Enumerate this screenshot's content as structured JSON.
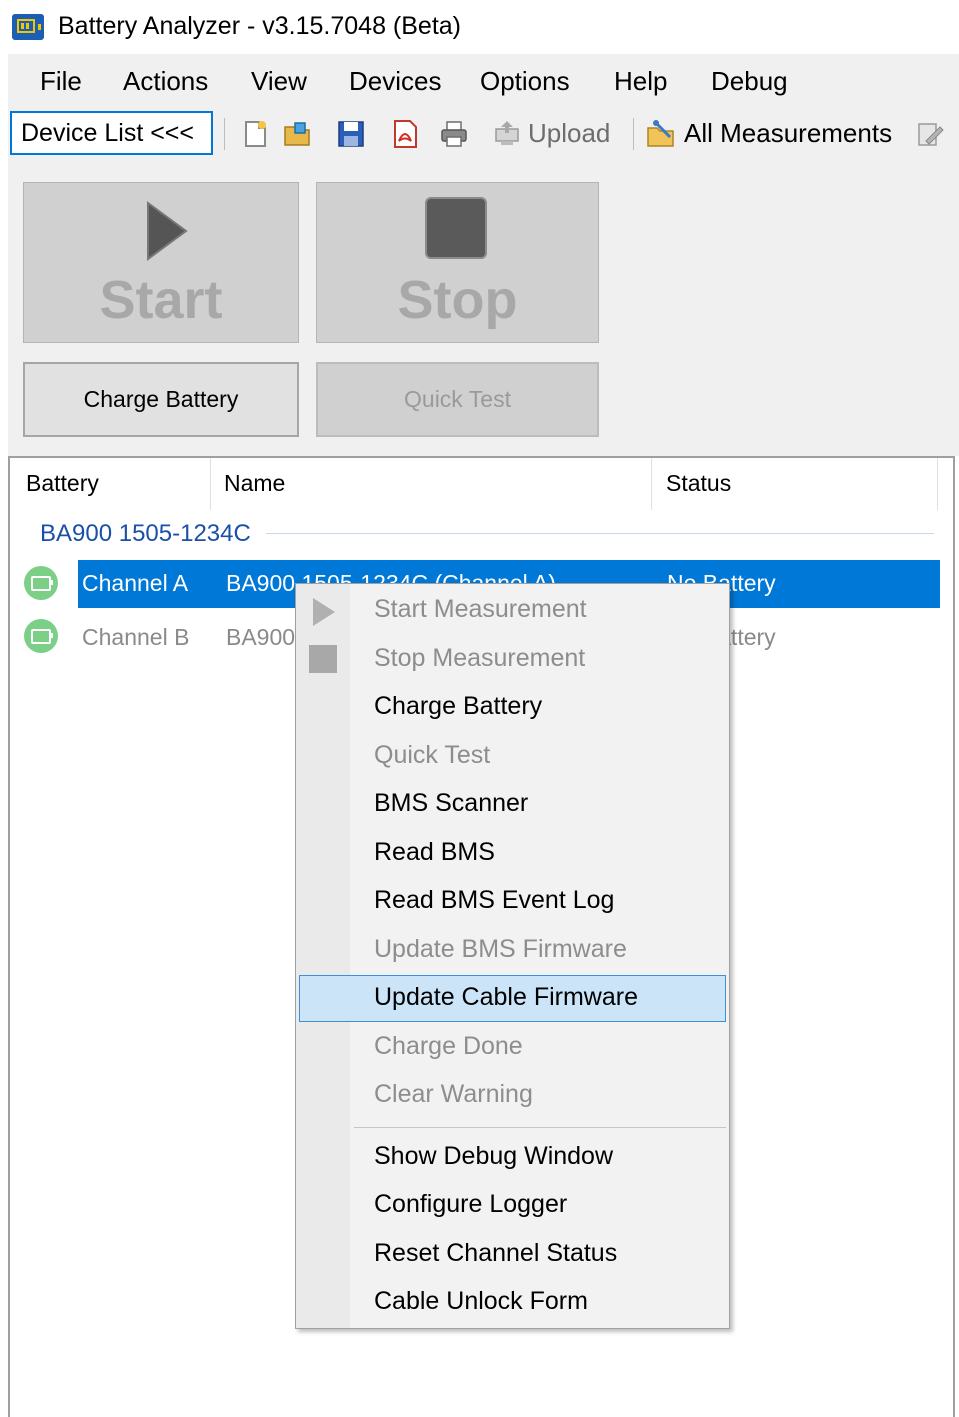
{
  "window": {
    "title": "Battery Analyzer - v3.15.7048 (Beta)"
  },
  "menubar": {
    "items": [
      "File",
      "Actions",
      "View",
      "Devices",
      "Options",
      "Help",
      "Debug"
    ]
  },
  "toolbar": {
    "device_list_label": "Device List <<<",
    "upload_label": "Upload",
    "all_measurements_label": "All Measurements"
  },
  "controls": {
    "start_label": "Start",
    "stop_label": "Stop",
    "charge_battery_label": "Charge Battery",
    "quick_test_label": "Quick Test"
  },
  "list": {
    "columns": [
      "Battery",
      "Name",
      "Status"
    ],
    "group": "BA900 1505-1234C",
    "rows": [
      {
        "battery": "Channel A",
        "name": "BA900 1505-1234C (Channel A)",
        "status": "No Battery",
        "selected": true
      },
      {
        "battery": "Channel B",
        "name": "BA900",
        "status": "No Battery",
        "selected": false
      }
    ]
  },
  "context_menu": {
    "items": [
      {
        "label": "Start Measurement",
        "enabled": false,
        "icon": "play-icon"
      },
      {
        "label": "Stop Measurement",
        "enabled": false,
        "icon": "stop-icon"
      },
      {
        "label": "Charge Battery",
        "enabled": true
      },
      {
        "label": "Quick Test",
        "enabled": false
      },
      {
        "label": "BMS Scanner",
        "enabled": true
      },
      {
        "label": "Read BMS",
        "enabled": true
      },
      {
        "label": "Read BMS Event Log",
        "enabled": true
      },
      {
        "label": "Update BMS Firmware",
        "enabled": false
      },
      {
        "label": "Update Cable Firmware",
        "enabled": true,
        "highlighted": true
      },
      {
        "label": "Charge Done",
        "enabled": false
      },
      {
        "label": "Clear Warning",
        "enabled": false
      },
      {
        "label": "Show Debug Window",
        "enabled": true
      },
      {
        "label": "Configure Logger",
        "enabled": true
      },
      {
        "label": "Reset Channel Status",
        "enabled": true
      },
      {
        "label": "Cable Unlock Form",
        "enabled": true
      }
    ]
  },
  "colors": {
    "accent": "#0078d7",
    "group_text": "#1b4fa8",
    "menu_highlight": "#cce4f7",
    "channel_icon": "#7ccf86",
    "disabled_text": "#8d8d8d"
  }
}
